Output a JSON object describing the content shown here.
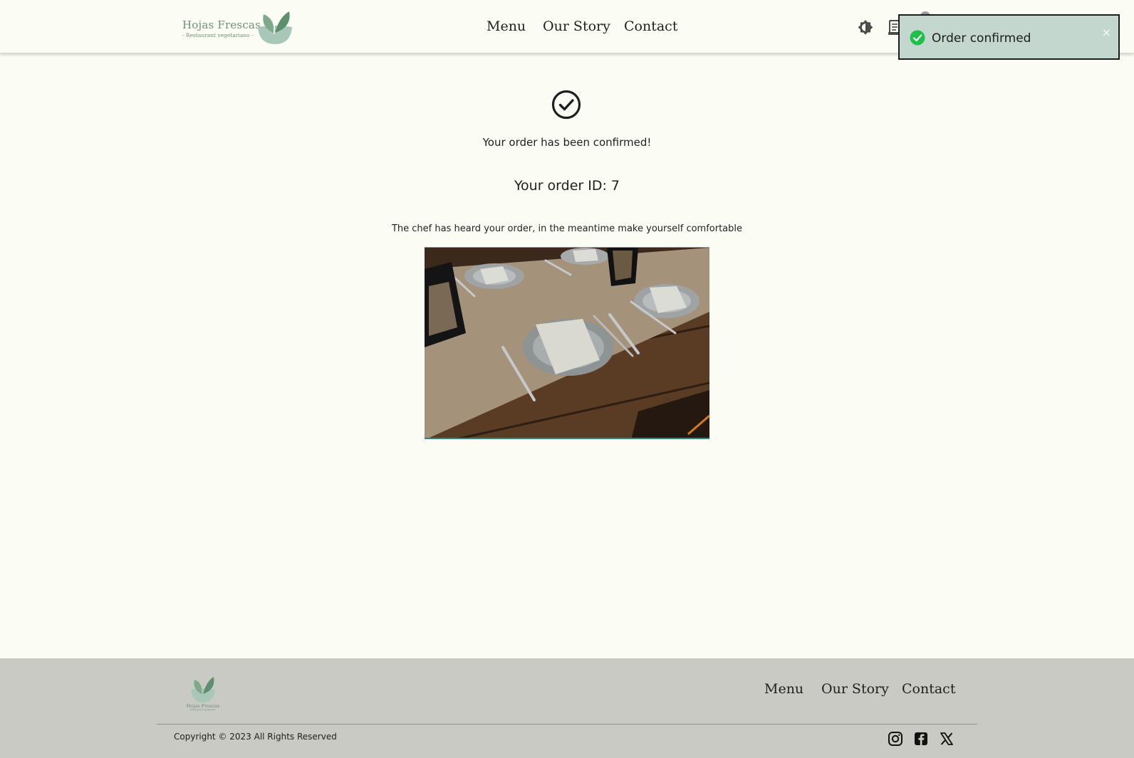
{
  "brand": {
    "name": "Hojas Frescas",
    "tagline": "- Restaurant vegetariano -",
    "footer_name": "Hojas Frescas",
    "footer_tagline": "Restaurant vegetariano"
  },
  "nav": {
    "menu": "Menu",
    "our_story": "Our Story",
    "contact": "Contact"
  },
  "header_icons": [
    "theme-toggle-icon",
    "receipt-icon",
    "user-icon"
  ],
  "toast": {
    "message": "Order confirmed",
    "close": "×"
  },
  "main": {
    "confirmation": "Your order has been confirmed!",
    "order_id": "Your order ID: 7",
    "chef_message": "The chef has heard your order, in the meantime make yourself comfortable"
  },
  "footer": {
    "nav": {
      "menu": "Menu",
      "our_story": "Our Story",
      "contact": "Contact"
    },
    "copyright": "Copyright © 2023 All Rights Reserved",
    "social": [
      "instagram-icon",
      "facebook-icon",
      "x-icon"
    ]
  },
  "colors": {
    "background": "#fbfdf5",
    "accent_green": "#6f8f74",
    "toast_bg": "#c3d7cf",
    "footer_bg": "#c8cac3",
    "success": "#1ec04a"
  }
}
